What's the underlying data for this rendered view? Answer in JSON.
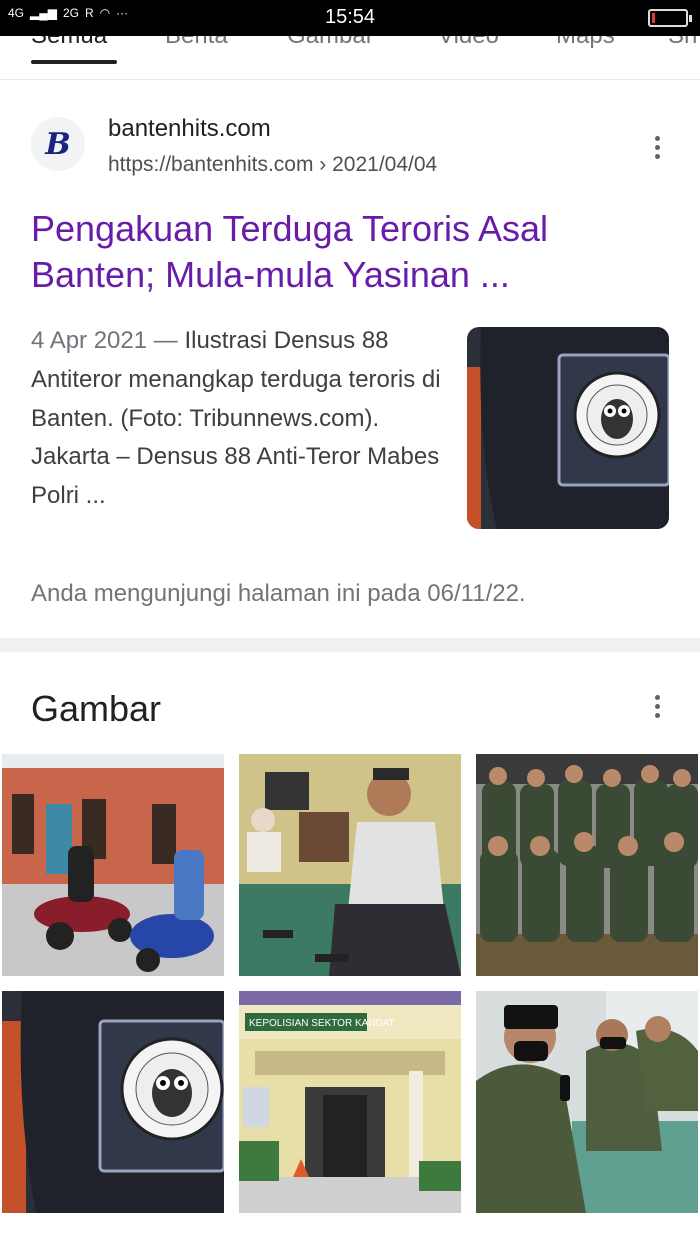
{
  "status_bar": {
    "network_left": "4G",
    "network_right": "2G",
    "roaming": "R",
    "more": "···",
    "time": "15:54",
    "battery_level": 0.1
  },
  "tabs": [
    {
      "label": "Semua",
      "active": true
    },
    {
      "label": "Berita",
      "active": false
    },
    {
      "label": "Gambar",
      "active": false
    },
    {
      "label": "Video",
      "active": false
    },
    {
      "label": "Maps",
      "active": false
    },
    {
      "label": "Sh",
      "active": false
    }
  ],
  "result": {
    "favicon_letter": "B",
    "site_name": "bantenhits.com",
    "url": "https://bantenhits.com › 2021/04/04",
    "title": "Pengakuan Terduga Teroris Asal Banten; Mula-mula Yasinan ...",
    "snippet_date": "4 Apr 2021 — ",
    "snippet_text": "Ilustrasi Densus 88 Antiteror menangkap terduga teroris di Banten. (Foto: Tribunnews.com). Jakarta – Densus 88 Anti-Teror Mabes Polri ...",
    "visited_note": "Anda mengunjungi halaman ini pada 06/11/22.",
    "patch_text_top": "DETASEMEN KHUSUS 88",
    "patch_text_bottom": "ANTI TEROR"
  },
  "images_section": {
    "title": "Gambar",
    "sign_text": "KEPOLISIAN SEKTOR KANDAT"
  },
  "colors": {
    "visited_link": "#681da8",
    "text_primary": "#202124",
    "text_secondary": "#70757a"
  }
}
